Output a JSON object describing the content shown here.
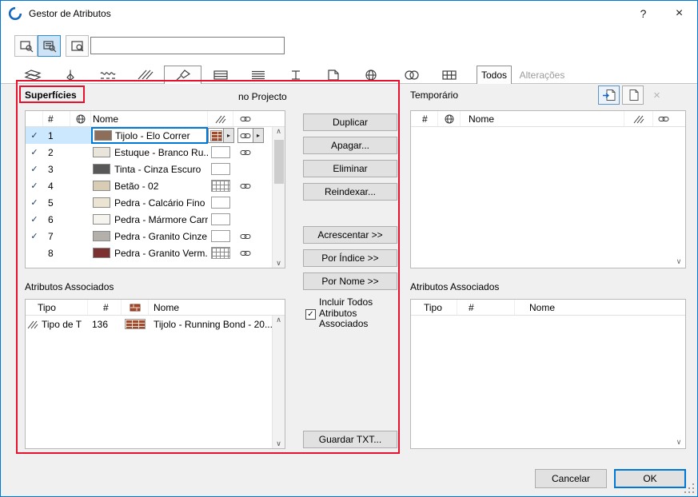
{
  "window": {
    "title": "Gestor de Atributos",
    "help_label": "?",
    "close_label": "×"
  },
  "toolbar": {
    "search_value": ""
  },
  "tabs": {
    "icon_tabs": [
      "layers",
      "pens",
      "line-types",
      "fill-types",
      "surfaces",
      "composites",
      "building-materials",
      "profiles",
      "zone-categories",
      "cities",
      "operation-profiles",
      "renovation-filters"
    ],
    "selected_icon_tab": "surfaces",
    "text_tabs": [
      {
        "label": "Todos",
        "state": "selected"
      },
      {
        "label": "Alterações",
        "state": "disabled"
      }
    ]
  },
  "left_panel": {
    "title": "Superfícies",
    "scope_label": "no Projecto",
    "table": {
      "headers": {
        "num": "#",
        "name": "Nome"
      },
      "rows": [
        {
          "checked": "✓",
          "num": "1",
          "name": "Tijolo - Elo Correr",
          "swatch": "#8d6e5b",
          "pattern": "brick",
          "linked": "true",
          "selected": true
        },
        {
          "checked": "✓",
          "num": "2",
          "name": "Estuque - Branco Ru...",
          "swatch": "#eae5da",
          "pattern": "plain",
          "linked": "true"
        },
        {
          "checked": "✓",
          "num": "3",
          "name": "Tinta - Cinza Escuro",
          "swatch": "#585858",
          "pattern": "plain",
          "linked": "false"
        },
        {
          "checked": "✓",
          "num": "4",
          "name": "Betão - 02",
          "swatch": "#d8ccb4",
          "pattern": "grid",
          "linked": "true"
        },
        {
          "checked": "✓",
          "num": "5",
          "name": "Pedra - Calcário Fino",
          "swatch": "#ece4d2",
          "pattern": "plain",
          "linked": "false"
        },
        {
          "checked": "✓",
          "num": "6",
          "name": "Pedra - Mármore Carr...",
          "swatch": "#f6f4ee",
          "pattern": "plain",
          "linked": "false"
        },
        {
          "checked": "✓",
          "num": "7",
          "name": "Pedra - Granito Cinze...",
          "swatch": "#b3b0ab",
          "pattern": "plain",
          "linked": "true"
        },
        {
          "checked": "",
          "num": "8",
          "name": "Pedra - Granito Verm...",
          "swatch": "#7d3030",
          "pattern": "grid",
          "linked": "true"
        }
      ]
    },
    "associated": {
      "title": "Atributos Associados",
      "headers": {
        "tipo": "Tipo",
        "num": "#",
        "name": "Nome"
      },
      "rows": [
        {
          "tipo": "Tipo de T",
          "num": "136",
          "name": "Tijolo - Running Bond - 20...",
          "pattern": "brick"
        }
      ]
    }
  },
  "actions": {
    "duplicar": "Duplicar",
    "apagar": "Apagar...",
    "eliminar": "Eliminar",
    "reindexar": "Reindexar...",
    "acrescentar": "Acrescentar >>",
    "por_indice": "Por Índice >>",
    "por_nome": "Por Nome >>",
    "incluir_lines": {
      "l1": "Incluir Todos",
      "l2": "Atributos",
      "l3": "Associados"
    },
    "incluir_checked": "✓",
    "guardar": "Guardar TXT..."
  },
  "right_panel": {
    "title": "Temporário",
    "table": {
      "headers": {
        "num": "#",
        "name": "Nome"
      }
    },
    "associated": {
      "title": "Atributos Associados",
      "headers": {
        "tipo": "Tipo",
        "num": "#",
        "name": "Nome"
      }
    }
  },
  "footer": {
    "cancel": "Cancelar",
    "ok": "OK"
  },
  "glyphs": {
    "dropdown": "▸",
    "scroll_up": "∧",
    "scroll_down": "∨"
  },
  "colors": {
    "accent": "#0078d7",
    "selection": "#cce8ff",
    "annotation": "#e8112d"
  }
}
